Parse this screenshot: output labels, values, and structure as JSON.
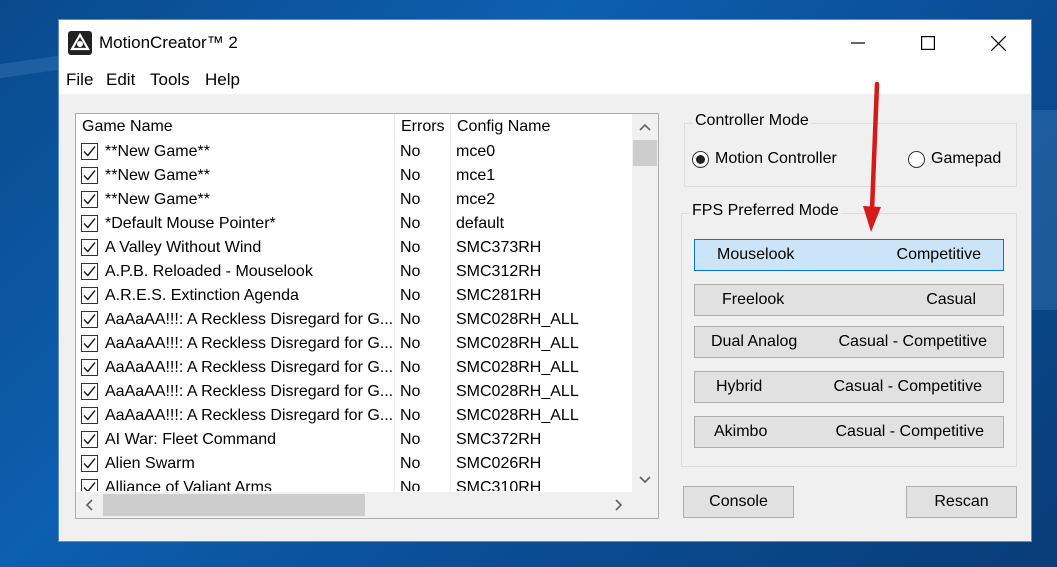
{
  "window": {
    "title": "MotionCreator™ 2"
  },
  "menu": [
    "File",
    "Edit",
    "Tools",
    "Help"
  ],
  "game_list": {
    "columns": [
      "Game Name",
      "Errors",
      "Config Name"
    ],
    "rows": [
      {
        "name": "**New Game**",
        "errors": "No",
        "config": "mce0",
        "checked": true
      },
      {
        "name": "**New Game**",
        "errors": "No",
        "config": "mce1",
        "checked": true
      },
      {
        "name": "**New Game**",
        "errors": "No",
        "config": "mce2",
        "checked": true
      },
      {
        "name": "*Default Mouse Pointer*",
        "errors": "No",
        "config": "default",
        "checked": true
      },
      {
        "name": "A Valley Without Wind",
        "errors": "No",
        "config": "SMC373RH",
        "checked": true
      },
      {
        "name": "A.P.B. Reloaded - Mouselook",
        "errors": "No",
        "config": "SMC312RH",
        "checked": true
      },
      {
        "name": "A.R.E.S. Extinction Agenda",
        "errors": "No",
        "config": "SMC281RH",
        "checked": true
      },
      {
        "name": "AaAaAA!!!: A Reckless Disregard for G...",
        "errors": "No",
        "config": "SMC028RH_ALL",
        "checked": true
      },
      {
        "name": "AaAaAA!!!: A Reckless Disregard for G...",
        "errors": "No",
        "config": "SMC028RH_ALL",
        "checked": true
      },
      {
        "name": "AaAaAA!!!: A Reckless Disregard for G...",
        "errors": "No",
        "config": "SMC028RH_ALL",
        "checked": true
      },
      {
        "name": "AaAaAA!!!: A Reckless Disregard for G...",
        "errors": "No",
        "config": "SMC028RH_ALL",
        "checked": true
      },
      {
        "name": "AaAaAA!!!: A Reckless Disregard for G...",
        "errors": "No",
        "config": "SMC028RH_ALL",
        "checked": true
      },
      {
        "name": "AI War: Fleet Command",
        "errors": "No",
        "config": "SMC372RH",
        "checked": true
      },
      {
        "name": "Alien Swarm",
        "errors": "No",
        "config": "SMC026RH",
        "checked": true
      },
      {
        "name": "Alliance of Valiant Arms",
        "errors": "No",
        "config": "SMC310RH",
        "checked": true
      }
    ]
  },
  "controller_mode": {
    "title": "Controller Mode",
    "options": [
      {
        "label": "Motion Controller",
        "selected": true
      },
      {
        "label": "Gamepad",
        "selected": false
      }
    ]
  },
  "fps_mode": {
    "title": "FPS Preferred Mode",
    "modes": [
      {
        "name": "Mouselook",
        "style": "Competitive",
        "selected": true
      },
      {
        "name": "Freelook",
        "style": "Casual",
        "selected": false
      },
      {
        "name": "Dual Analog",
        "style": "Casual - Competitive",
        "selected": false
      },
      {
        "name": "Hybrid",
        "style": "Casual - Competitive",
        "selected": false
      },
      {
        "name": "Akimbo",
        "style": "Casual - Competitive",
        "selected": false
      }
    ]
  },
  "buttons": {
    "console": "Console",
    "rescan": "Rescan"
  },
  "icons": {
    "app": "motioncreator-logo-icon",
    "minimize": "minimize-icon",
    "maximize": "maximize-icon",
    "close": "close-icon",
    "annotation": "red-arrow-annotation"
  },
  "colors": {
    "selection": "#cce4f7",
    "selection_border": "#0078d7",
    "annotation": "#d61a1a"
  }
}
